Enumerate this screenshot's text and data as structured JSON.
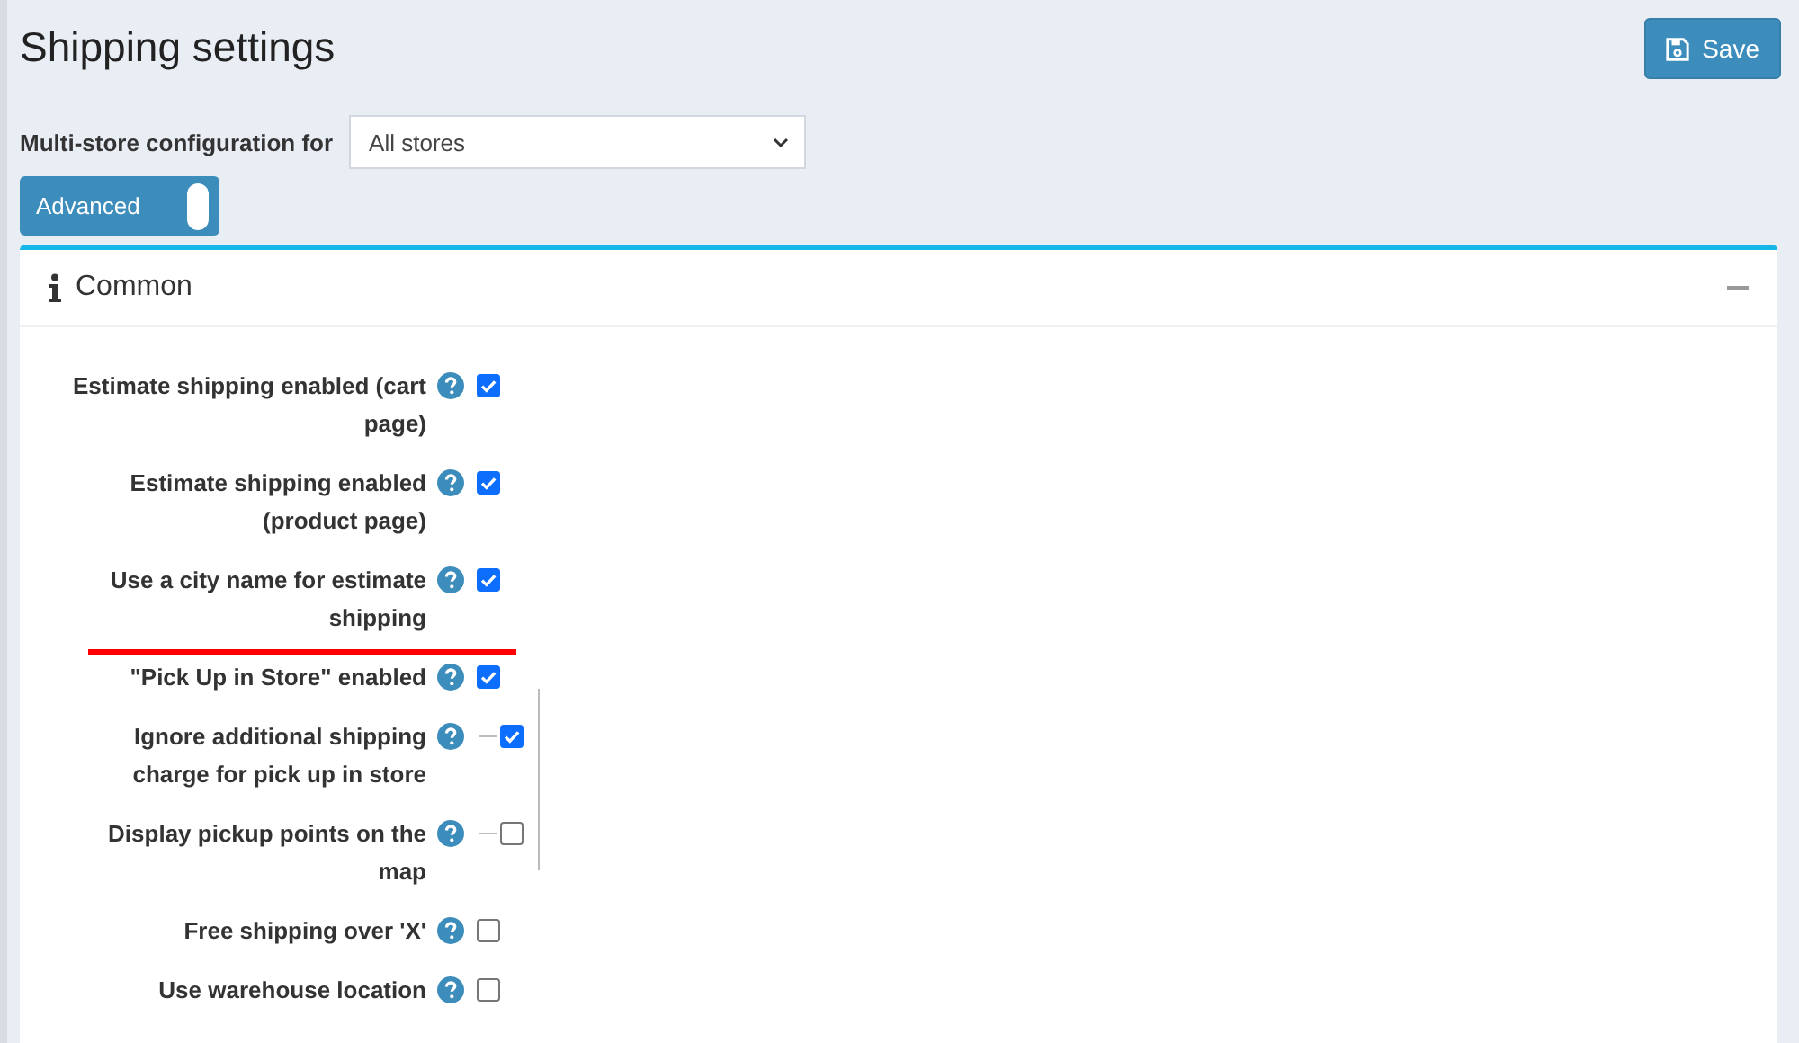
{
  "page": {
    "title": "Shipping settings",
    "save_button": "Save"
  },
  "store_config": {
    "label": "Multi-store configuration for",
    "value": "All stores"
  },
  "mode_toggle": {
    "label": "Advanced",
    "on": true
  },
  "panel": {
    "title": "Common",
    "expanded": true,
    "settings": [
      {
        "label": "Estimate shipping enabled (cart page)",
        "checked": true
      },
      {
        "label": "Estimate shipping enabled (product page)",
        "checked": true
      },
      {
        "label": "Use a city name for estimate shipping",
        "checked": true,
        "underlined": true
      },
      {
        "label": "\"Pick Up in Store\" enabled",
        "checked": true,
        "children": [
          {
            "label": "Ignore additional shipping charge for pick up in store",
            "checked": true
          },
          {
            "label": "Display pickup points on the map",
            "checked": false
          }
        ]
      },
      {
        "label": "Free shipping over 'X'",
        "checked": false
      },
      {
        "label": "Use warehouse location",
        "checked": false
      }
    ]
  }
}
